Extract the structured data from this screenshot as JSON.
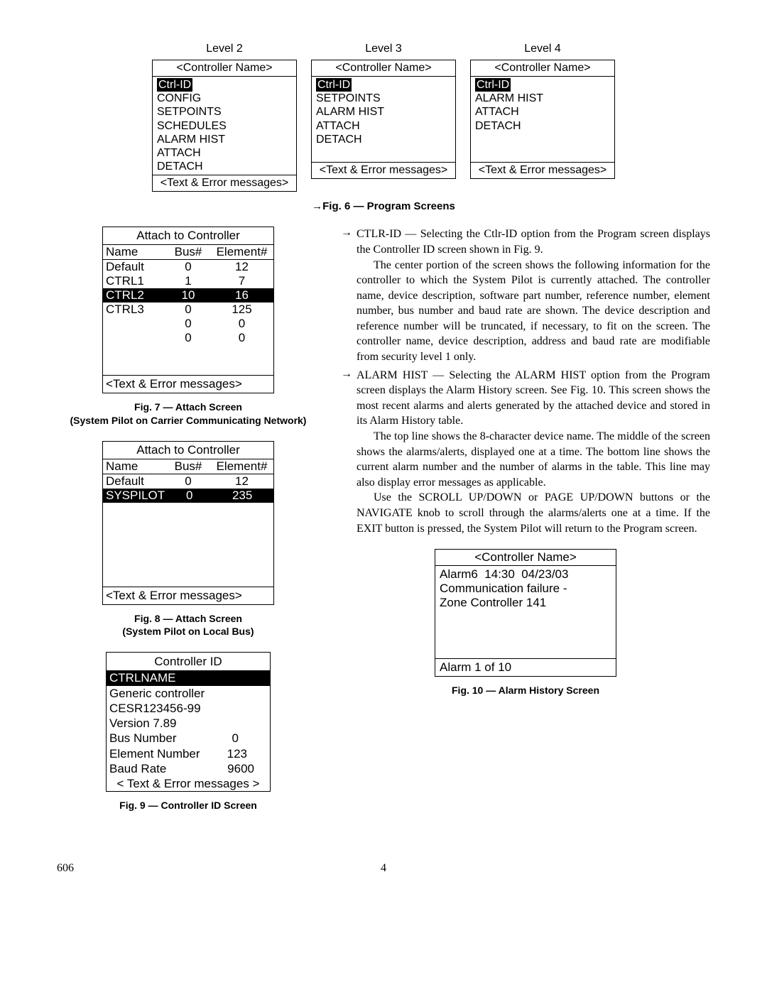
{
  "levels": {
    "level2": {
      "label": "Level 2",
      "header": "<Controller Name>",
      "items": [
        "Ctrl-ID",
        "CONFIG",
        "SETPOINTS",
        "SCHEDULES",
        "ALARM HIST",
        "ATTACH",
        "DETACH"
      ],
      "footer": "<Text & Error messages>"
    },
    "level3": {
      "label": "Level 3",
      "header": "<Controller Name>",
      "items": [
        "Ctrl-ID",
        "SETPOINTS",
        "ALARM HIST",
        "ATTACH",
        "DETACH"
      ],
      "footer": "<Text & Error messages>"
    },
    "level4": {
      "label": "Level 4",
      "header": "<Controller Name>",
      "items": [
        "Ctrl-ID",
        "ALARM HIST",
        "ATTACH",
        "DETACH"
      ],
      "footer": "<Text & Error messages>"
    }
  },
  "fig6_caption": "→Fig. 6 — Program Screens",
  "fig7": {
    "title": "Attach to Controller",
    "headers": [
      "Name",
      "Bus#",
      "Element#"
    ],
    "rows": [
      {
        "name": "Default",
        "bus": "0",
        "elem": "12"
      },
      {
        "name": "CTRL1",
        "bus": "1",
        "elem": "7"
      },
      {
        "name": "CTRL2",
        "bus": "10",
        "elem": "16",
        "hl": true
      },
      {
        "name": "CTRL3",
        "bus": "0",
        "elem": "125"
      },
      {
        "name": "",
        "bus": "0",
        "elem": "0"
      },
      {
        "name": "",
        "bus": "0",
        "elem": "0"
      }
    ],
    "footer": "<Text & Error messages>",
    "caption1": "Fig. 7 — Attach Screen",
    "caption2": "(System Pilot on Carrier Communicating Network)"
  },
  "fig8": {
    "title": "Attach to Controller",
    "headers": [
      "Name",
      "Bus#",
      "Element#"
    ],
    "rows": [
      {
        "name": "Default",
        "bus": "0",
        "elem": "12"
      },
      {
        "name": "SYSPILOT",
        "bus": "0",
        "elem": "235",
        "hl": true
      }
    ],
    "footer": "<Text & Error messages>",
    "caption1": "Fig. 8 — Attach Screen",
    "caption2": "(System Pilot on Local Bus)"
  },
  "fig9": {
    "title": "Controller ID",
    "ctrlname": "CTRLNAME",
    "lines": [
      "Generic controller",
      "CESR123456-99",
      "Version 7.89"
    ],
    "kv": [
      {
        "k": "Bus Number",
        "v": "0"
      },
      {
        "k": "Element Number",
        "v": "123"
      },
      {
        "k": "Baud Rate",
        "v": "9600"
      }
    ],
    "footer": "< Text & Error messages >",
    "caption": "Fig. 9 — Controller ID Screen"
  },
  "right_text": {
    "bullet1_lead": "CTLR-ID — Selecting the Ctlr-ID option from the Program screen displays the Controller ID screen shown in Fig. 9.",
    "para1": "The center portion of the screen shows the following information for the controller to which the System Pilot is currently attached. The controller name, device description, software part number, reference number, element number, bus number and baud rate are shown. The device description and reference number will be truncated, if necessary, to fit on the screen. The controller name, device description, address and baud rate are modifiable from security level 1 only.",
    "bullet2_lead": "ALARM HIST — Selecting the ALARM HIST option from the Program screen displays the Alarm History screen. See Fig. 10. This screen shows the most recent alarms and alerts generated by the attached device and stored in its Alarm History table.",
    "para2": "The top line shows the 8-character device name. The middle of the screen shows the alarms/alerts, displayed one at a time. The bottom line shows the current alarm number and the number of alarms in the table. This line may also display error messages as applicable.",
    "para3": "Use the SCROLL UP/DOWN or PAGE UP/DOWN buttons or the NAVIGATE knob to scroll through the alarms/alerts one at a time. If the EXIT button is pressed, the System Pilot will return to the Program screen."
  },
  "fig10": {
    "header": "<Controller Name>",
    "line1": "Alarm6  14:30  04/23/03",
    "line2": "Communication failure -",
    "line3": "Zone Controller 141",
    "footer": "Alarm 1 of 10",
    "caption": "Fig. 10 — Alarm History Screen"
  },
  "page_footer": {
    "left": "606",
    "center": "4"
  }
}
